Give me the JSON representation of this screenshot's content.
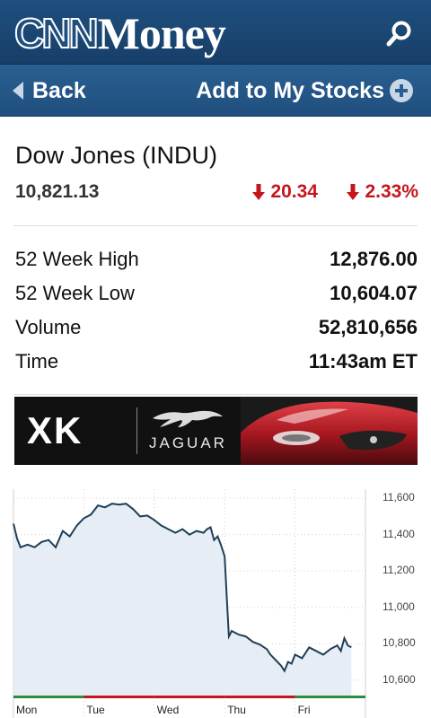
{
  "header": {
    "logo_cnn": "CNN",
    "logo_money": "Money",
    "search_icon": "search-icon"
  },
  "nav": {
    "back_label": "Back",
    "add_label": "Add to My Stocks",
    "add_icon": "plus-circle-icon"
  },
  "stock": {
    "title": "Dow Jones (INDU)",
    "price": "10,821.13",
    "change_points": "20.34",
    "change_percent": "2.33%",
    "direction": "down",
    "down_color": "#c4161c"
  },
  "stats": [
    {
      "label": "52 Week High",
      "value": "12,876.00"
    },
    {
      "label": "52 Week Low",
      "value": "10,604.07"
    },
    {
      "label": "Volume",
      "value": "52,810,656"
    },
    {
      "label": "Time",
      "value": "11:43am ET"
    }
  ],
  "ad": {
    "model": "XK",
    "brand": "JAGUAR"
  },
  "colors": {
    "header_blue": "#1f4f7e",
    "line_color": "#1f3f57",
    "fill_color": "#e7edf5",
    "session_up": "#2e8b3e",
    "session_down": "#c4161c"
  },
  "chart_data": {
    "type": "area",
    "title": "",
    "xlabel": "",
    "ylabel": "",
    "ylim": [
      10500,
      11650
    ],
    "y_ticks": [
      10600,
      10800,
      11000,
      11200,
      11400,
      11600
    ],
    "y_tick_labels": [
      "10,600",
      "10,800",
      "11,000",
      "11,200",
      "11,400",
      "11,600"
    ],
    "categories": [
      "Mon",
      "Tue",
      "Wed",
      "Thu",
      "Fri"
    ],
    "grid": true,
    "session_colors": [
      "up",
      "down",
      "down",
      "down",
      "up"
    ],
    "series": [
      {
        "values": [
          [
            0.0,
            11460
          ],
          [
            0.05,
            11380
          ],
          [
            0.1,
            11330
          ],
          [
            0.2,
            11345
          ],
          [
            0.3,
            11330
          ],
          [
            0.4,
            11360
          ],
          [
            0.5,
            11370
          ],
          [
            0.6,
            11330
          ],
          [
            0.7,
            11420
          ],
          [
            0.8,
            11390
          ],
          [
            0.9,
            11450
          ],
          [
            1.0,
            11490
          ],
          [
            1.1,
            11510
          ],
          [
            1.2,
            11560
          ],
          [
            1.3,
            11550
          ],
          [
            1.4,
            11570
          ],
          [
            1.5,
            11565
          ],
          [
            1.6,
            11570
          ],
          [
            1.7,
            11540
          ],
          [
            1.8,
            11500
          ],
          [
            1.9,
            11505
          ],
          [
            2.0,
            11480
          ],
          [
            2.1,
            11450
          ],
          [
            2.2,
            11430
          ],
          [
            2.3,
            11410
          ],
          [
            2.4,
            11430
          ],
          [
            2.5,
            11400
          ],
          [
            2.6,
            11420
          ],
          [
            2.7,
            11410
          ],
          [
            2.75,
            11430
          ],
          [
            2.8,
            11440
          ],
          [
            2.85,
            11370
          ],
          [
            2.9,
            11390
          ],
          [
            2.95,
            11340
          ],
          [
            3.0,
            11280
          ],
          [
            3.03,
            11050
          ],
          [
            3.06,
            10840
          ],
          [
            3.1,
            10870
          ],
          [
            3.2,
            10850
          ],
          [
            3.3,
            10840
          ],
          [
            3.4,
            10810
          ],
          [
            3.5,
            10795
          ],
          [
            3.6,
            10770
          ],
          [
            3.65,
            10740
          ],
          [
            3.7,
            10720
          ],
          [
            3.75,
            10700
          ],
          [
            3.8,
            10680
          ],
          [
            3.85,
            10650
          ],
          [
            3.9,
            10700
          ],
          [
            3.95,
            10690
          ],
          [
            4.0,
            10740
          ],
          [
            4.1,
            10720
          ],
          [
            4.2,
            10780
          ],
          [
            4.3,
            10760
          ],
          [
            4.4,
            10740
          ],
          [
            4.5,
            10770
          ],
          [
            4.6,
            10790
          ],
          [
            4.65,
            10760
          ],
          [
            4.7,
            10830
          ],
          [
            4.75,
            10790
          ],
          [
            4.8,
            10780
          ]
        ]
      }
    ]
  }
}
